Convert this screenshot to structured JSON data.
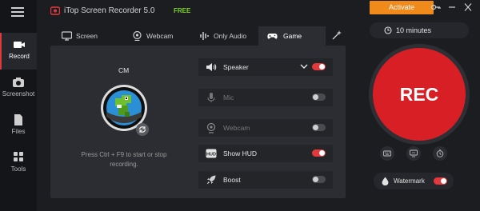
{
  "app": {
    "title": "iTop Screen Recorder 5.0",
    "badge": "FREE",
    "activate_label": "Activate"
  },
  "sidebar": {
    "items": [
      {
        "label": "Record"
      },
      {
        "label": "Screenshot"
      },
      {
        "label": "Files"
      },
      {
        "label": "Tools"
      }
    ]
  },
  "tabs": [
    {
      "label": "Screen"
    },
    {
      "label": "Webcam"
    },
    {
      "label": "Only Audio"
    },
    {
      "label": "Game"
    }
  ],
  "game": {
    "name": "CM",
    "hint": "Press Ctrl + F9 to start or stop recording."
  },
  "options": [
    {
      "label": "Speaker",
      "on": true
    },
    {
      "label": "Mic",
      "on": false
    },
    {
      "label": "Webcam",
      "on": false
    },
    {
      "label": "Show HUD",
      "on": true
    },
    {
      "label": "Boost",
      "on": false
    }
  ],
  "recorder": {
    "timer_label": "10 minutes",
    "rec_label": "REC",
    "watermark_label": "Watermark",
    "watermark_on": true
  },
  "colors": {
    "accent_red": "#d81f25",
    "activate_orange": "#f08a1a",
    "free_green": "#7ed321"
  }
}
